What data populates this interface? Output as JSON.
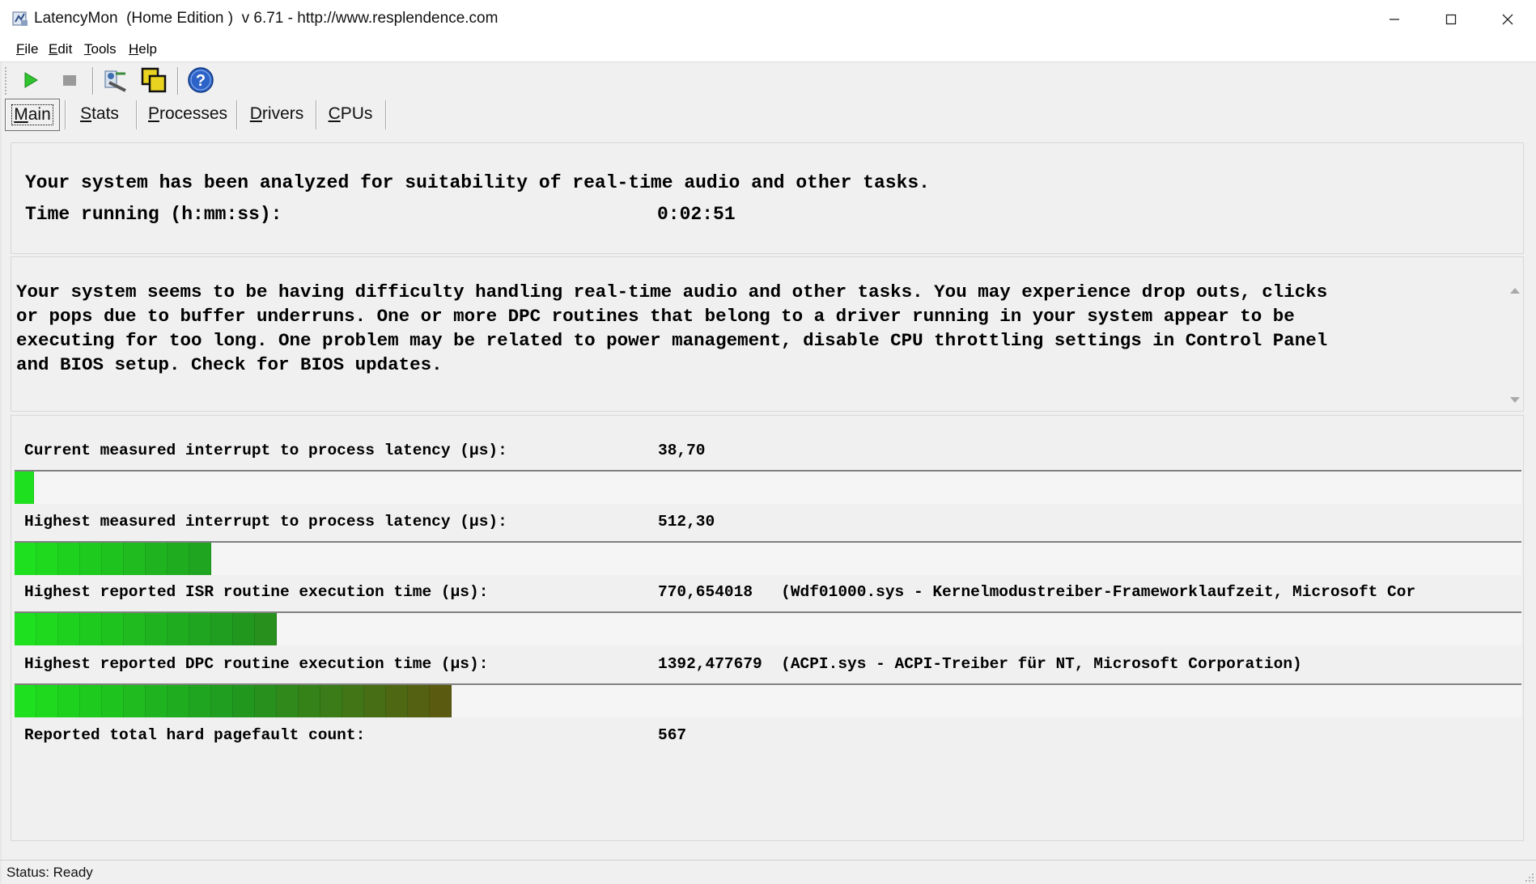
{
  "window": {
    "title": "LatencyMon  (Home Edition )  v 6.71 - http://www.resplendence.com"
  },
  "menu": [
    {
      "ul": "F",
      "rest": "ile"
    },
    {
      "ul": "E",
      "rest": "dit"
    },
    {
      "ul": "T",
      "rest": "ools"
    },
    {
      "ul": "H",
      "rest": "elp"
    }
  ],
  "toolbar": {
    "icons": [
      "play-icon",
      "stop-icon",
      "driver-tool-icon",
      "cpu-chips-icon",
      "help-icon"
    ]
  },
  "tabs": [
    {
      "ul": "M",
      "rest": "ain",
      "active": true
    },
    {
      "ul": "S",
      "rest": "tats",
      "active": false
    },
    {
      "ul": "P",
      "rest": "rocesses",
      "active": false
    },
    {
      "ul": "D",
      "rest": "rivers",
      "active": false
    },
    {
      "ul": "C",
      "rest": "PUs",
      "active": false
    }
  ],
  "summary": {
    "analysis_text": "Your system has been analyzed for suitability of real-time audio and other tasks.",
    "time_label": "Time running (h:mm:ss):",
    "time_value": "0:02:51"
  },
  "message": {
    "text": "Your system seems to be having difficulty handling real-time audio and other tasks. You may experience drop outs, clicks\nor pops due to buffer underruns. One or more DPC routines that belong to a driver running in your system appear to be\nexecuting for too long. One problem may be related to power management, disable CPU throttling settings in Control Panel\nand BIOS setup. Check for BIOS updates."
  },
  "metrics": {
    "current_latency": {
      "label": "Current measured interrupt to process latency (µs):",
      "value": "38,70",
      "bar_segments": 1
    },
    "highest_latency": {
      "label": "Highest measured interrupt to process latency (µs):",
      "value": "512,30",
      "bar_segments": 9
    },
    "isr": {
      "label": "Highest reported ISR routine execution time (µs):",
      "value": "770,654018   (Wdf01000.sys - Kernelmodustreiber-Frameworklaufzeit, Microsoft Cor",
      "bar_segments": 12
    },
    "dpc": {
      "label": "Highest reported DPC routine execution time (µs):",
      "value": "1392,477679  (ACPI.sys - ACPI-Treiber für NT, Microsoft Corporation)",
      "bar_segments": 20
    },
    "pagefault": {
      "label": "Reported total hard pagefault count:",
      "value": "567"
    }
  },
  "colors": {
    "bar_start": "#1ee01e",
    "bar_mid": "#1f9a1f",
    "bar_end": "#5a5a10"
  },
  "status": {
    "text": "Status: Ready"
  }
}
